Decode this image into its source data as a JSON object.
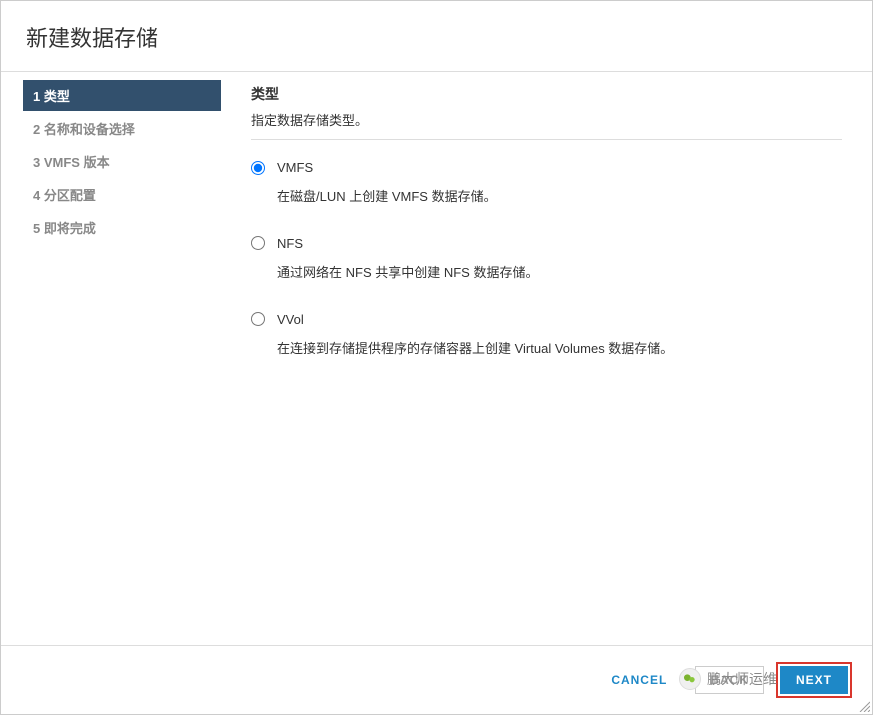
{
  "dialog": {
    "title": "新建数据存储"
  },
  "sidebar": {
    "steps": [
      {
        "num": "1",
        "label": "类型",
        "active": true
      },
      {
        "num": "2",
        "label": "名称和设备选择",
        "active": false
      },
      {
        "num": "3",
        "label": "VMFS 版本",
        "active": false
      },
      {
        "num": "4",
        "label": "分区配置",
        "active": false
      },
      {
        "num": "5",
        "label": "即将完成",
        "active": false
      }
    ]
  },
  "main": {
    "title": "类型",
    "subtitle": "指定数据存储类型。",
    "options": [
      {
        "id": "vmfs",
        "label": "VMFS",
        "description": "在磁盘/LUN 上创建 VMFS 数据存储。",
        "selected": true
      },
      {
        "id": "nfs",
        "label": "NFS",
        "description": "通过网络在 NFS 共享中创建 NFS 数据存储。",
        "selected": false
      },
      {
        "id": "vvol",
        "label": "VVol",
        "description": "在连接到存储提供程序的存储容器上创建 Virtual Volumes 数据存储。",
        "selected": false
      }
    ]
  },
  "footer": {
    "cancel": "CANCEL",
    "back": "BACK",
    "next": "NEXT"
  },
  "watermark": {
    "text": "鹏大师运维"
  }
}
